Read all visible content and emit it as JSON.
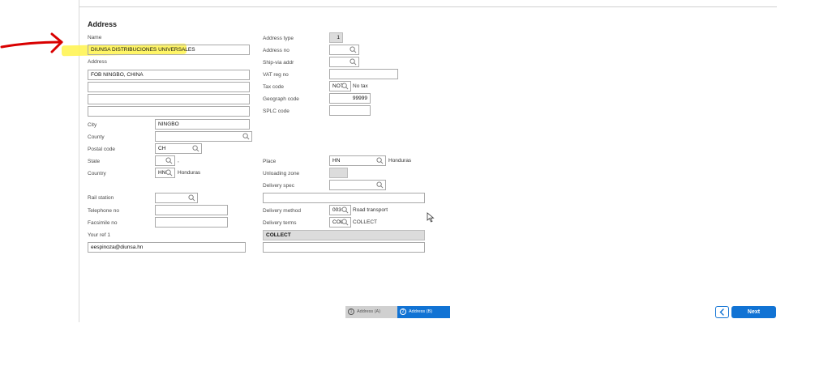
{
  "section": {
    "title": "Address"
  },
  "left": {
    "name_label": "Name",
    "name_value": "DIUNSA DISTRIBUCIONES UNIVERSALES",
    "address_label": "Address",
    "address_lines": [
      "FOB NINGBO, CHINA",
      "",
      "",
      ""
    ],
    "city_label": "City",
    "city_value": "NINGBO",
    "county_label": "County",
    "county_value": "",
    "postal_label": "Postal code",
    "postal_value": "CH",
    "state_label": "State",
    "state_value": "",
    "state_desc": ",",
    "country_label": "Country",
    "country_value": "HN",
    "country_desc": "Honduras",
    "rail_label": "Rail station",
    "rail_value": "",
    "telephone_label": "Telephone no",
    "telephone_value": "",
    "fax_label": "Facsimile no",
    "fax_value": "",
    "yourref_label": "Your ref 1",
    "yourref_value": "eespinoza@diunsa.hn"
  },
  "right": {
    "address_type_label": "Address type",
    "address_type_value": "1",
    "address_no_label": "Address no",
    "address_no_value": "",
    "shipvia_label": "Ship-via addr",
    "shipvia_value": "",
    "vat_label": "VAT reg no",
    "vat_value": "",
    "tax_label": "Tax code",
    "tax_value": "NOT",
    "tax_desc": "No tax",
    "geograph_label": "Geograph code",
    "geograph_value": "99999",
    "splc_label": "SPLC code",
    "splc_value": "",
    "place_label": "Place",
    "place_value": "HN",
    "place_desc": "Honduras",
    "unloading_label": "Unloading zone",
    "unloading_value": "",
    "delivery_spec_label": "Delivery spec",
    "delivery_spec_value": "",
    "delivery_spec_text": "",
    "delivery_method_label": "Delivery method",
    "delivery_method_value": "003",
    "delivery_method_desc": "Road transport",
    "delivery_terms_label": "Delivery terms",
    "delivery_terms_value": "COL",
    "delivery_terms_desc": "COLLECT",
    "terms_text": "COLLECT",
    "extra_text": ""
  },
  "footer": {
    "steps": [
      {
        "num": "1",
        "label": "Address (A)"
      },
      {
        "num": "2",
        "label": "Address (B)"
      }
    ],
    "next_label": "Next"
  },
  "colors": {
    "accent": "#1173d4",
    "highlight": "#fff455",
    "annotation": "#d90000"
  },
  "icons": {
    "search": "magnifier-icon",
    "back": "chevron-left-icon"
  }
}
